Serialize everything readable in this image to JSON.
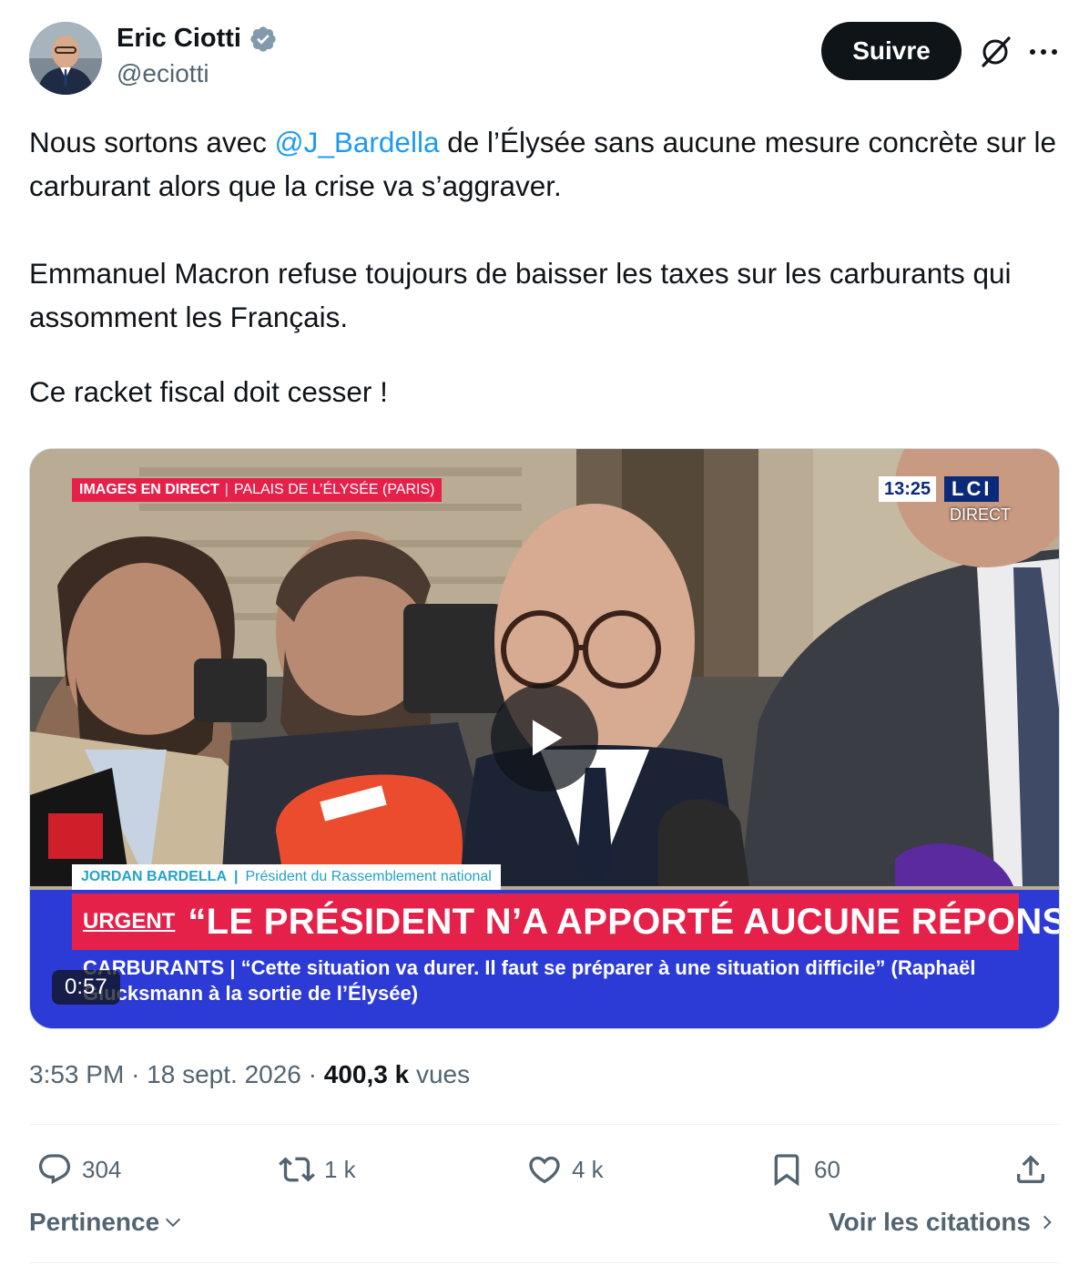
{
  "author": {
    "display_name": "Eric Ciotti",
    "handle": "@eciotti",
    "verified": true
  },
  "header": {
    "follow_label": "Suivre"
  },
  "tweet": {
    "line1_before": "Nous sortons avec ",
    "mention": "@J_Bardella",
    "line1_after": " de l’Élysée sans aucune mesure concrète sur le carburant alors que la crise va s’aggraver.",
    "paragraph2": "Emmanuel Macron refuse toujours de baisser les taxes sur les carburants qui assomment les Français.",
    "paragraph3": "Ce racket fiscal doit cesser !"
  },
  "video": {
    "duration": "0:57",
    "overlay": {
      "live_tag": "IMAGES EN DIRECT",
      "live_place": "PALAIS DE L’ÉLYSÉE (PARIS)",
      "clock": "13:25",
      "channel": "LCI",
      "channel_status": "DIRECT",
      "speaker_name": "JORDAN BARDELLA",
      "speaker_role": "Président du Rassemblement national",
      "urgent_label": "URGENT",
      "headline": "“LE PRÉSIDENT N’A APPORTÉ AUCUNE RÉPONSE”",
      "ticker_label": "CARBURANTS |",
      "ticker_text": "“Cette situation va durer. Il faut se préparer à une situation difficile” (Raphaël Glucksmann à la sortie de l’Élysée)"
    }
  },
  "meta": {
    "time": "3:53 PM",
    "date": "18 sept. 2026",
    "views_count": "400,3 k",
    "views_label": "vues"
  },
  "actions": {
    "replies": "304",
    "reposts": "1 k",
    "likes": "4 k",
    "bookmarks": "60"
  },
  "footer": {
    "sort_label": "Pertinence",
    "quotes_label": "Voir les citations"
  },
  "colors": {
    "accent": "#1d9bf0",
    "text": "#0f1419",
    "secondary": "#536471"
  }
}
